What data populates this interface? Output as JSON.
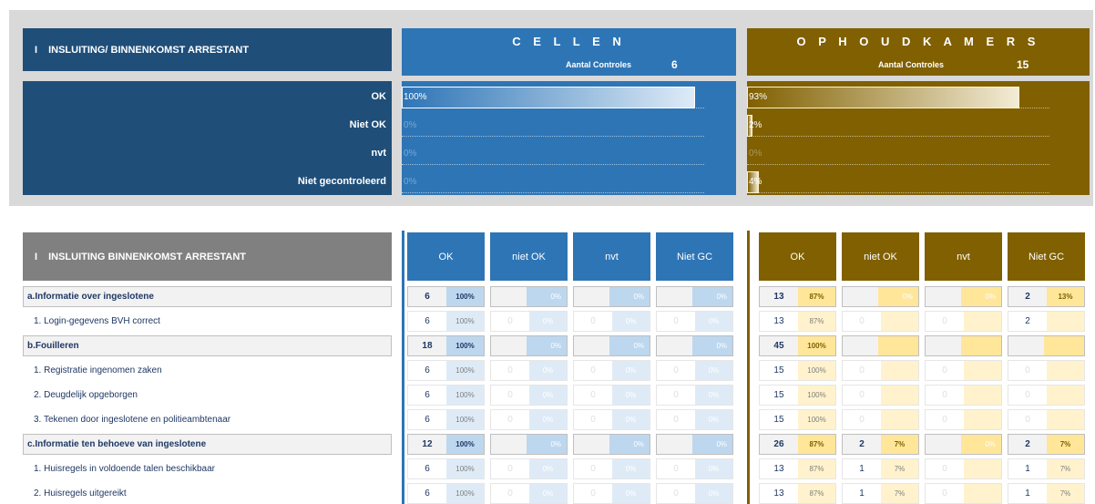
{
  "summary": {
    "title": "INSLUITING/ BINNENKOMST ARRESTANT",
    "row_labels": [
      "OK",
      "Niet OK",
      "nvt",
      "Niet gecontroleerd"
    ],
    "cellen": {
      "title": "C E L L E N",
      "controles_label": "Aantal Controles",
      "controles_value": "6",
      "percentages": [
        "100%",
        "0%",
        "0%",
        "0%"
      ],
      "fractions": [
        1.0,
        0.0,
        0.0,
        0.0
      ]
    },
    "ophoudkamers": {
      "title": "O P H O U D K A M E R S",
      "controles_label": "Aantal Controles",
      "controles_value": "15",
      "percentages": [
        "93%",
        "2%",
        "0%",
        "4%"
      ],
      "fractions": [
        0.93,
        0.02,
        0.0,
        0.04
      ]
    }
  },
  "table": {
    "title": "INSLUITING BINNENKOMST ARRESTANT",
    "cellen_headers": [
      "OK",
      "niet OK",
      "nvt",
      "Niet GC"
    ],
    "oph_headers": [
      "OK",
      "niet OK",
      "nvt",
      "Niet GC"
    ],
    "rows": [
      {
        "type": "section",
        "label": "a.Informatie over ingeslotene",
        "cel": [
          [
            "6",
            "100%"
          ],
          [
            "",
            "0%"
          ],
          [
            "",
            "0%"
          ],
          [
            "",
            "0%"
          ]
        ],
        "oph": [
          [
            "13",
            "87%"
          ],
          [
            "",
            "0%"
          ],
          [
            "",
            "0%"
          ],
          [
            "2",
            "13%"
          ]
        ]
      },
      {
        "type": "item",
        "label": "1. Login-gegevens BVH correct",
        "cel": [
          [
            "6",
            "100%"
          ],
          [
            "0",
            "0%"
          ],
          [
            "0",
            "0%"
          ],
          [
            "0",
            "0%"
          ]
        ],
        "oph": [
          [
            "13",
            "87%"
          ],
          [
            "0",
            ""
          ],
          [
            "0",
            ""
          ],
          [
            "2",
            ""
          ]
        ]
      },
      {
        "type": "section",
        "label": "b.Fouilleren",
        "cel": [
          [
            "18",
            "100%"
          ],
          [
            "",
            "0%"
          ],
          [
            "",
            "0%"
          ],
          [
            "",
            "0%"
          ]
        ],
        "oph": [
          [
            "45",
            "100%"
          ],
          [
            "",
            ""
          ],
          [
            "",
            ""
          ],
          [
            "",
            ""
          ]
        ]
      },
      {
        "type": "item",
        "label": "1. Registratie ingenomen zaken",
        "cel": [
          [
            "6",
            "100%"
          ],
          [
            "0",
            "0%"
          ],
          [
            "0",
            "0%"
          ],
          [
            "0",
            "0%"
          ]
        ],
        "oph": [
          [
            "15",
            "100%"
          ],
          [
            "0",
            ""
          ],
          [
            "0",
            ""
          ],
          [
            "0",
            ""
          ]
        ]
      },
      {
        "type": "item",
        "label": "2. Deugdelijk opgeborgen",
        "cel": [
          [
            "6",
            "100%"
          ],
          [
            "0",
            "0%"
          ],
          [
            "0",
            "0%"
          ],
          [
            "0",
            "0%"
          ]
        ],
        "oph": [
          [
            "15",
            "100%"
          ],
          [
            "0",
            ""
          ],
          [
            "0",
            ""
          ],
          [
            "0",
            ""
          ]
        ]
      },
      {
        "type": "item",
        "label": "3. Tekenen door ingeslotene en politieambtenaar",
        "cel": [
          [
            "6",
            "100%"
          ],
          [
            "0",
            "0%"
          ],
          [
            "0",
            "0%"
          ],
          [
            "0",
            "0%"
          ]
        ],
        "oph": [
          [
            "15",
            "100%"
          ],
          [
            "0",
            ""
          ],
          [
            "0",
            ""
          ],
          [
            "0",
            ""
          ]
        ]
      },
      {
        "type": "section",
        "label": "c.Informatie ten behoeve van ingeslotene",
        "cel": [
          [
            "12",
            "100%"
          ],
          [
            "",
            "0%"
          ],
          [
            "",
            "0%"
          ],
          [
            "",
            "0%"
          ]
        ],
        "oph": [
          [
            "26",
            "87%"
          ],
          [
            "2",
            "7%"
          ],
          [
            "",
            "0%"
          ],
          [
            "2",
            "7%"
          ]
        ]
      },
      {
        "type": "item",
        "label": "1. Huisregels in voldoende talen beschikbaar",
        "cel": [
          [
            "6",
            "100%"
          ],
          [
            "0",
            "0%"
          ],
          [
            "0",
            "0%"
          ],
          [
            "0",
            "0%"
          ]
        ],
        "oph": [
          [
            "13",
            "87%"
          ],
          [
            "1",
            "7%"
          ],
          [
            "0",
            ""
          ],
          [
            "1",
            "7%"
          ]
        ]
      },
      {
        "type": "item",
        "label": "2. Huisregels uitgereikt",
        "cel": [
          [
            "6",
            "100%"
          ],
          [
            "0",
            "0%"
          ],
          [
            "0",
            "0%"
          ],
          [
            "0",
            "0%"
          ]
        ],
        "oph": [
          [
            "13",
            "87%"
          ],
          [
            "1",
            "7%"
          ],
          [
            "0",
            ""
          ],
          [
            "1",
            "7%"
          ]
        ]
      }
    ]
  },
  "colors": {
    "navy": "#1f4e79",
    "blue": "#2e75b6",
    "gold": "#806000",
    "gray": "#808080"
  }
}
